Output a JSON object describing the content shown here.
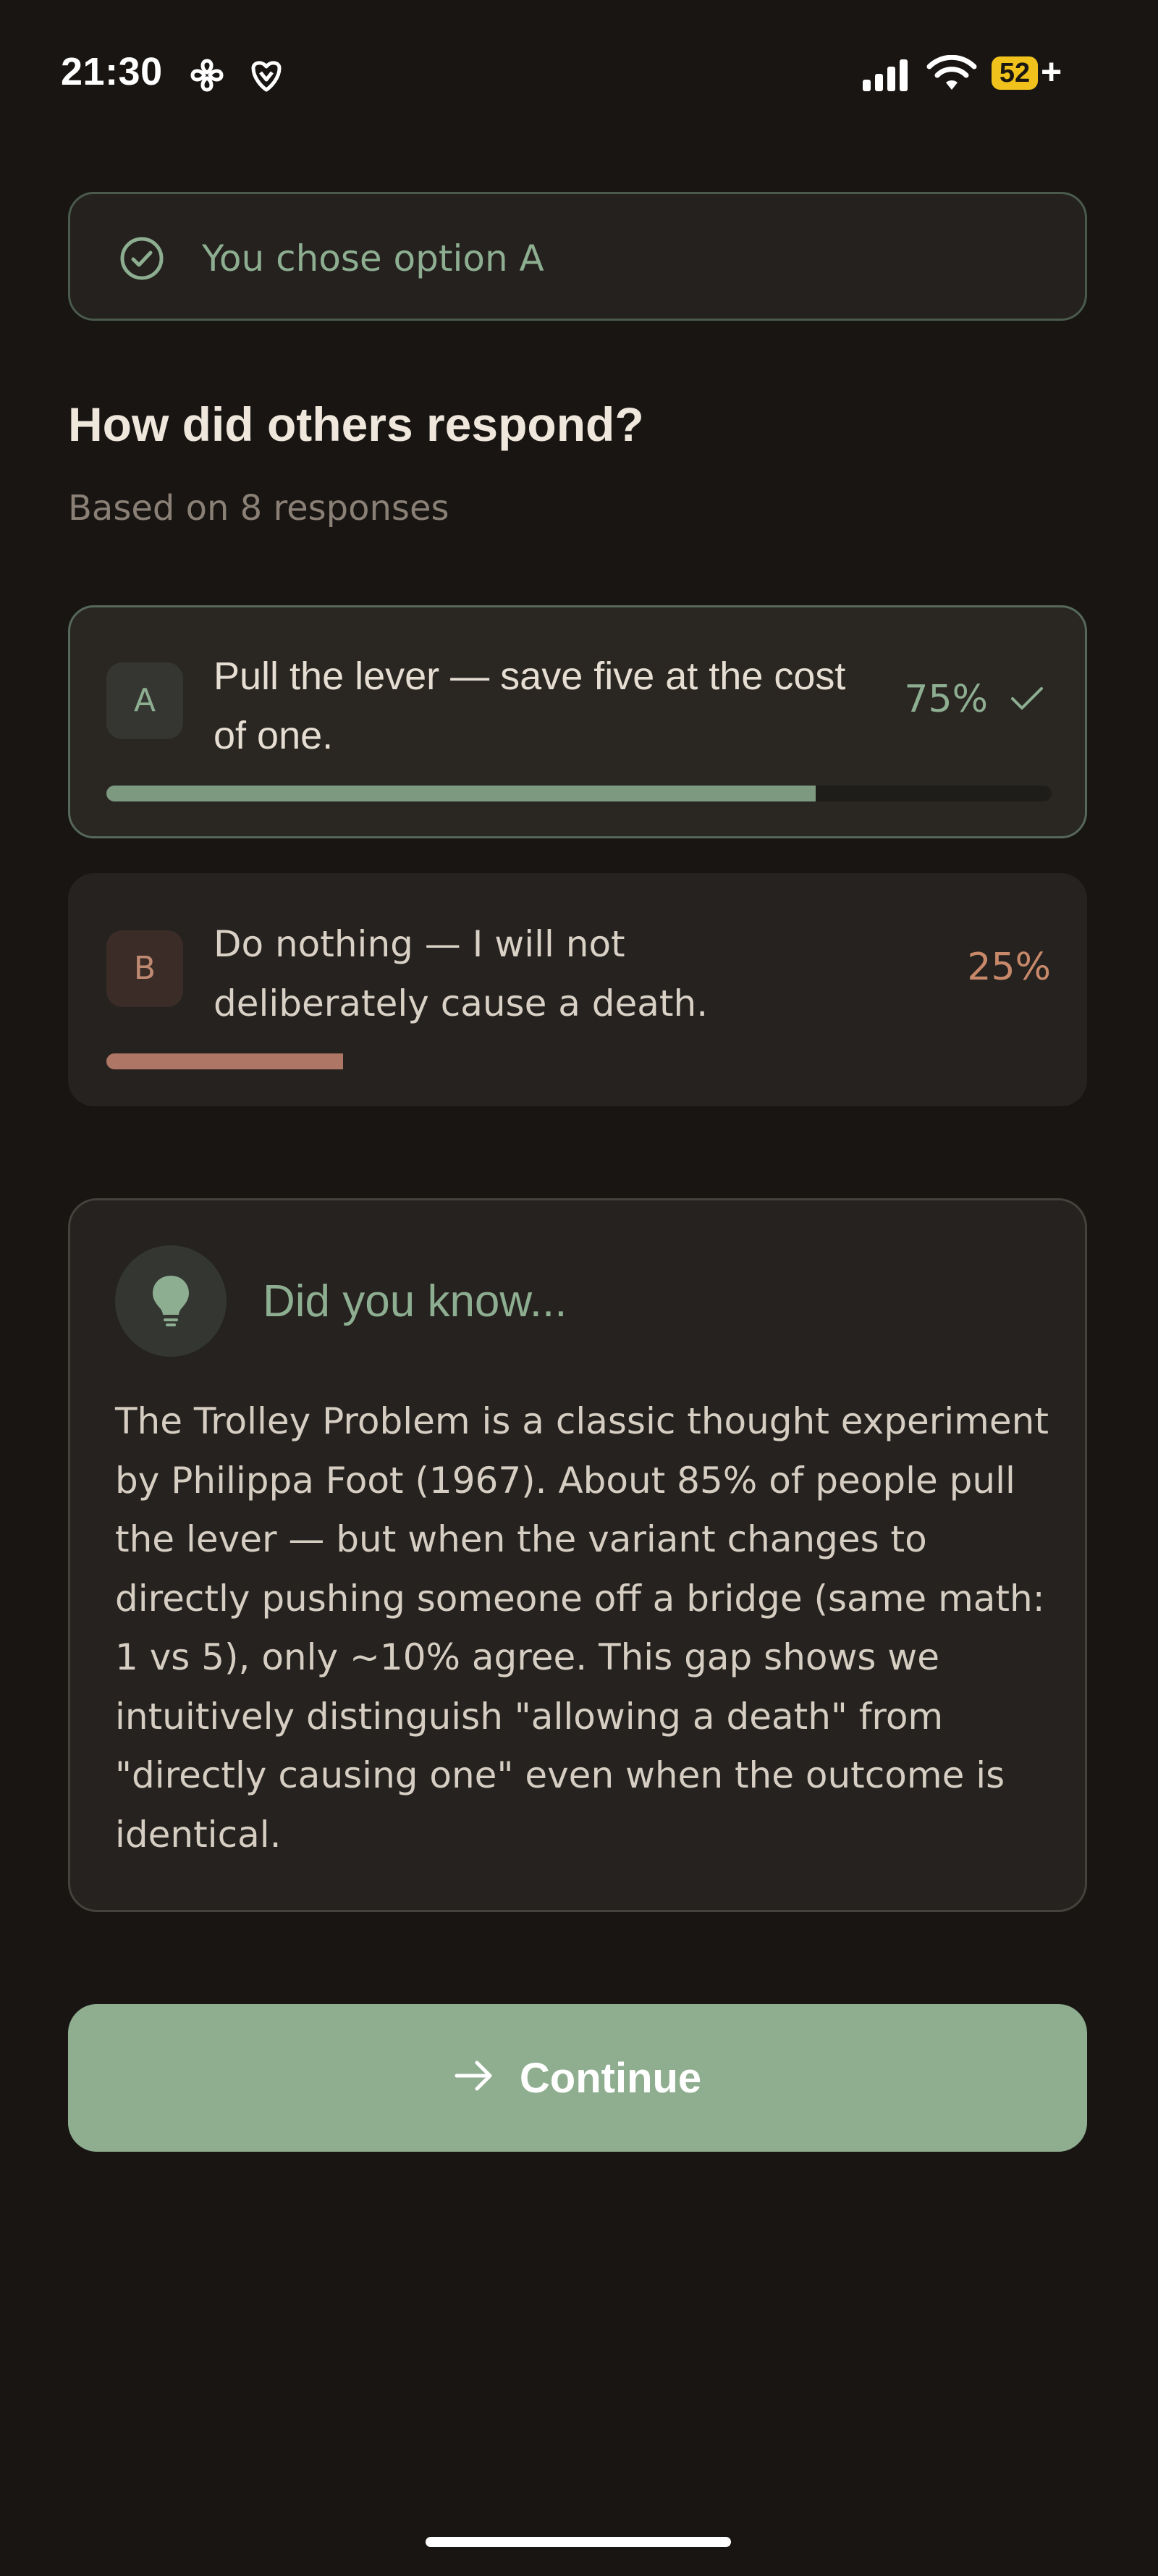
{
  "status_bar": {
    "time": "21:30",
    "battery_level": "52",
    "battery_plus": "+",
    "icons": [
      "app-notification-icon",
      "app-notification-icon-2",
      "signal-icon",
      "wifi-icon",
      "battery-icon"
    ]
  },
  "choice_banner": {
    "text": "You chose option A",
    "icon": "check-circle-icon"
  },
  "results": {
    "title": "How did others respond?",
    "subtitle": "Based on 8 responses",
    "options": [
      {
        "letter": "A",
        "text": "Pull the lever — save five at the cost of one.",
        "percent_label": "75%",
        "percent": 75,
        "selected": true
      },
      {
        "letter": "B",
        "text": "Do nothing — I will not deliberately cause a death.",
        "percent_label": "25%",
        "percent": 25,
        "selected": false
      }
    ]
  },
  "did_you_know": {
    "title": "Did you know...",
    "icon": "lightbulb-icon",
    "body": "The Trolley Problem is a classic thought experiment by Philippa Foot (1967). About 85% of people pull the lever — but when the variant changes to directly pushing someone off a bridge (same math: 1 vs 5), only ~10% agree. This gap shows we intuitively distinguish \"allowing a death\" from \"directly causing one\" even when the outcome is identical."
  },
  "continue_button": {
    "label": "Continue",
    "icon": "arrow-right-icon"
  },
  "colors": {
    "background": "#181513",
    "accent_green": "#8fae90",
    "accent_terracotta": "#c8896b",
    "battery": "#f2c21c"
  }
}
